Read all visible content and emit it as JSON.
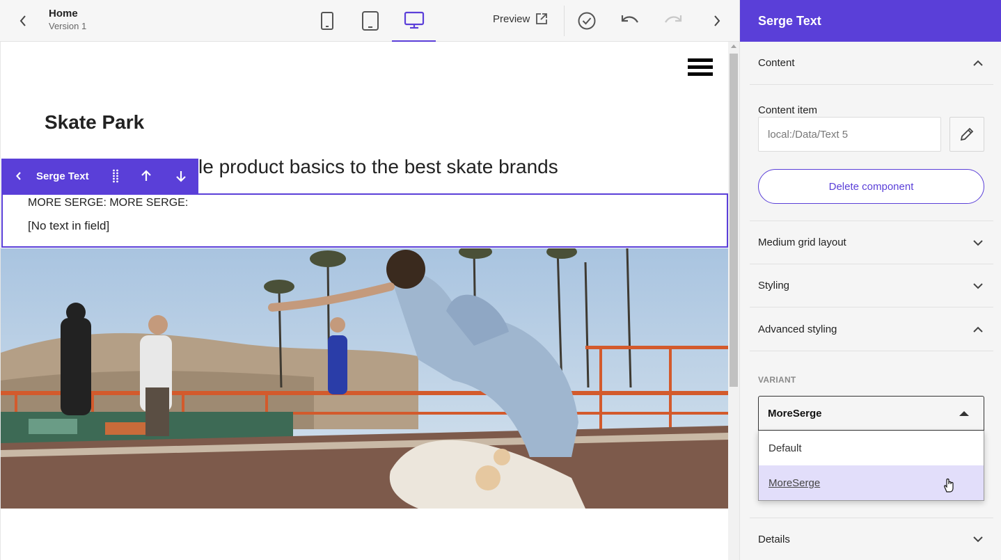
{
  "topbar": {
    "title": "Home",
    "version": "Version 1",
    "preview_label": "Preview",
    "active_device": "desktop"
  },
  "canvas": {
    "heading": "Skate Park",
    "subheading": "From kids ... le product basics to the best skate brands",
    "subheading_visible": "le product basics to the best skate brands",
    "component_toolbar": {
      "label": "Serge Text"
    },
    "selected_text": {
      "line1": "MORE SERGE: MORE SERGE:",
      "line2": "[No text in field]"
    }
  },
  "panel": {
    "title": "Serge Text",
    "sections": {
      "content": "Content",
      "medium_grid": "Medium grid layout",
      "styling": "Styling",
      "advanced_styling": "Advanced styling",
      "details": "Details"
    },
    "content_item": {
      "label": "Content item",
      "value": "local:/Data/Text 5"
    },
    "delete_label": "Delete component",
    "variant": {
      "label": "VARIANT",
      "selected": "MoreSerge",
      "options": [
        "Default",
        "MoreSerge"
      ],
      "highlighted": "MoreSerge"
    }
  },
  "colors": {
    "accent": "#5a3fd8",
    "highlight": "#e2defa"
  }
}
